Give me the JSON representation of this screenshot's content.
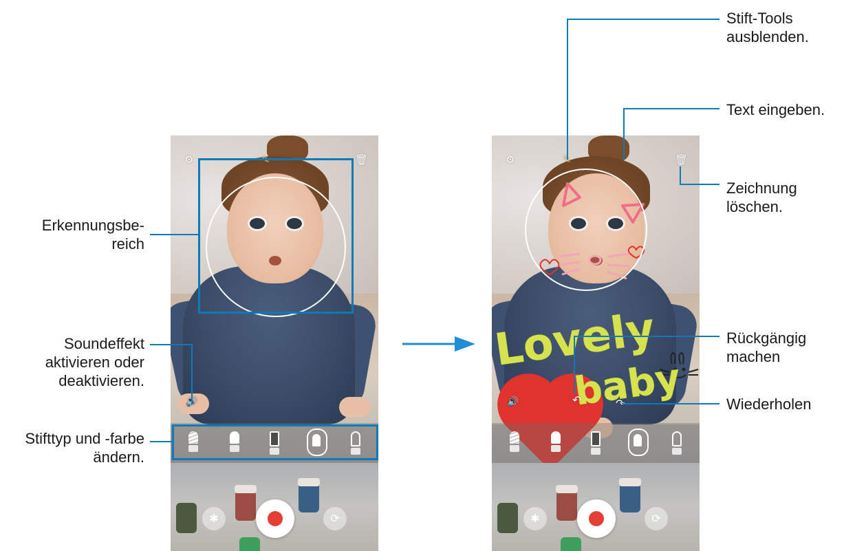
{
  "left_screen": {
    "top_icons": {
      "settings": "⚙",
      "pen": "✎",
      "delete": "🗑"
    },
    "sound_icon": "🔊",
    "switch_camera_icon": "⟳",
    "effects_icon": "✱"
  },
  "right_screen": {
    "top_icons": {
      "settings": "⚙",
      "pen": "✎",
      "delete": "🗑"
    },
    "sound_icon": "🔊",
    "drawn_text_line1": "Lovely",
    "drawn_text_line2": "baby",
    "undo_icon": "↶",
    "redo_icon": "↷",
    "switch_camera_icon": "⟳",
    "effects_icon": "✱"
  },
  "annotations": {
    "recognition_area": "Erkennungsbe-\nreich",
    "sound_effect": "Soundeffekt\naktivieren oder\ndeaktivieren.",
    "pen_type_color": "Stifttyp und -farbe\nändern.",
    "hide_pen_tools": "Stift-Tools\nausblenden.",
    "enter_text": "Text eingeben.",
    "clear_drawing": "Zeichnung\nlöschen.",
    "undo": "Rückgängig\nmachen",
    "redo": "Wiederholen"
  },
  "colors": {
    "callout": "#0f7ab8",
    "record": "#e53f35",
    "drawing_yellow": "#d6e24e",
    "drawing_red": "#e0332e",
    "drawing_pink": "#f06d8a"
  }
}
